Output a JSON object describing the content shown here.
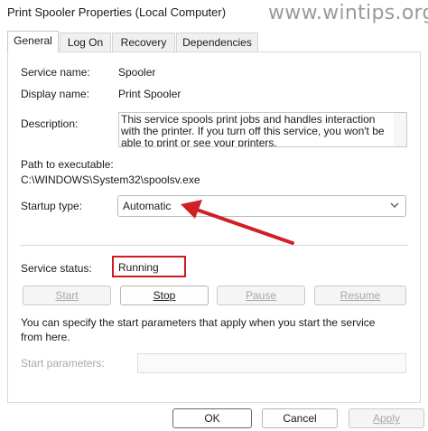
{
  "window": {
    "title": "Print Spooler Properties (Local Computer)"
  },
  "watermark": "www.wintips.org",
  "tabs": [
    "General",
    "Log On",
    "Recovery",
    "Dependencies"
  ],
  "fields": {
    "service_name_label": "Service name:",
    "service_name_value": "Spooler",
    "display_name_label": "Display name:",
    "display_name_value": "Print Spooler",
    "description_label": "Description:",
    "description_text": "This service spools print jobs and handles interaction with the printer.  If you turn off this service, you won't be able to print or see your printers.",
    "path_label": "Path to executable:",
    "path_value": "C:\\WINDOWS\\System32\\spoolsv.exe",
    "startup_type_label": "Startup type:",
    "startup_type_value": "Automatic"
  },
  "status": {
    "label": "Service status:",
    "value": "Running"
  },
  "service_buttons": {
    "start": "Start",
    "stop": "Stop",
    "pause": "Pause",
    "resume": "Resume"
  },
  "params": {
    "info_text": "You can specify the start parameters that apply when you start the service from here.",
    "label": "Start parameters:",
    "value": ""
  },
  "footer": {
    "ok": "OK",
    "cancel": "Cancel",
    "apply": "Apply"
  },
  "colors": {
    "annotation_red": "#d01920",
    "arrow_red": "#d01f26"
  },
  "icons": {
    "annotation_arrow": "arrow-icon",
    "dropdown": "chevron-down-icon"
  }
}
